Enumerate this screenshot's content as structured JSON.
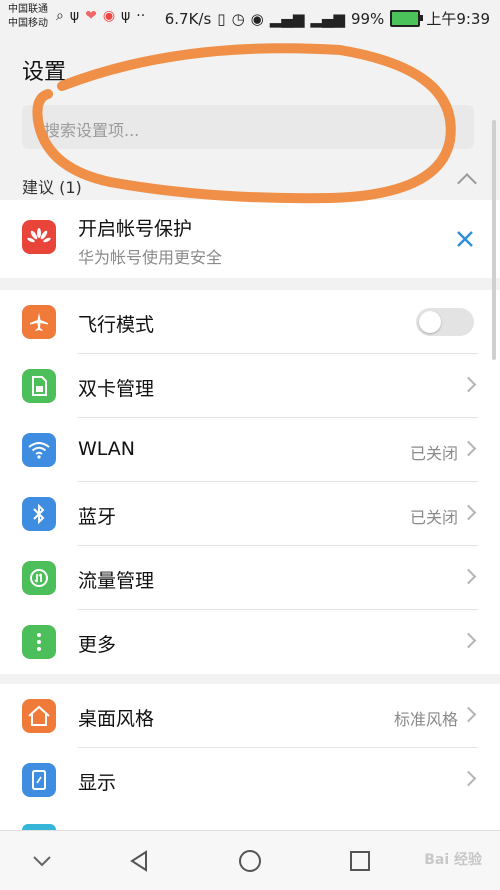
{
  "statusbar": {
    "carrier1": "中国联通",
    "carrier2": "中国移动",
    "speed": "6.7K/s",
    "battery": "99%",
    "time": "上午9:39"
  },
  "header": {
    "title": "设置"
  },
  "search": {
    "placeholder": "搜索设置项..."
  },
  "suggestions": {
    "label": "建议 (1)",
    "item": {
      "title": "开启帐号保护",
      "subtitle": "华为帐号使用更安全"
    }
  },
  "group1": [
    {
      "title": "飞行模式",
      "type": "toggle",
      "on": false,
      "icon": "airplane-icon",
      "color": "#f07a3a"
    },
    {
      "title": "双卡管理",
      "type": "chevron",
      "icon": "sim-icon",
      "color": "#4cbf5a"
    },
    {
      "title": "WLAN",
      "value": "已关闭",
      "type": "chevron",
      "icon": "wifi-icon",
      "color": "#3e8de0"
    },
    {
      "title": "蓝牙",
      "value": "已关闭",
      "type": "chevron",
      "icon": "bluetooth-icon",
      "color": "#3e8de0"
    },
    {
      "title": "流量管理",
      "type": "chevron",
      "icon": "data-usage-icon",
      "color": "#4cbf5a"
    },
    {
      "title": "更多",
      "type": "chevron",
      "icon": "more-icon",
      "color": "#4cbf5a"
    }
  ],
  "group2": [
    {
      "title": "桌面风格",
      "value": "标准风格",
      "icon": "home-icon",
      "color": "#f07a3a"
    },
    {
      "title": "显示",
      "icon": "display-icon",
      "color": "#3e8de0"
    }
  ],
  "watermark": "Bai 经验"
}
